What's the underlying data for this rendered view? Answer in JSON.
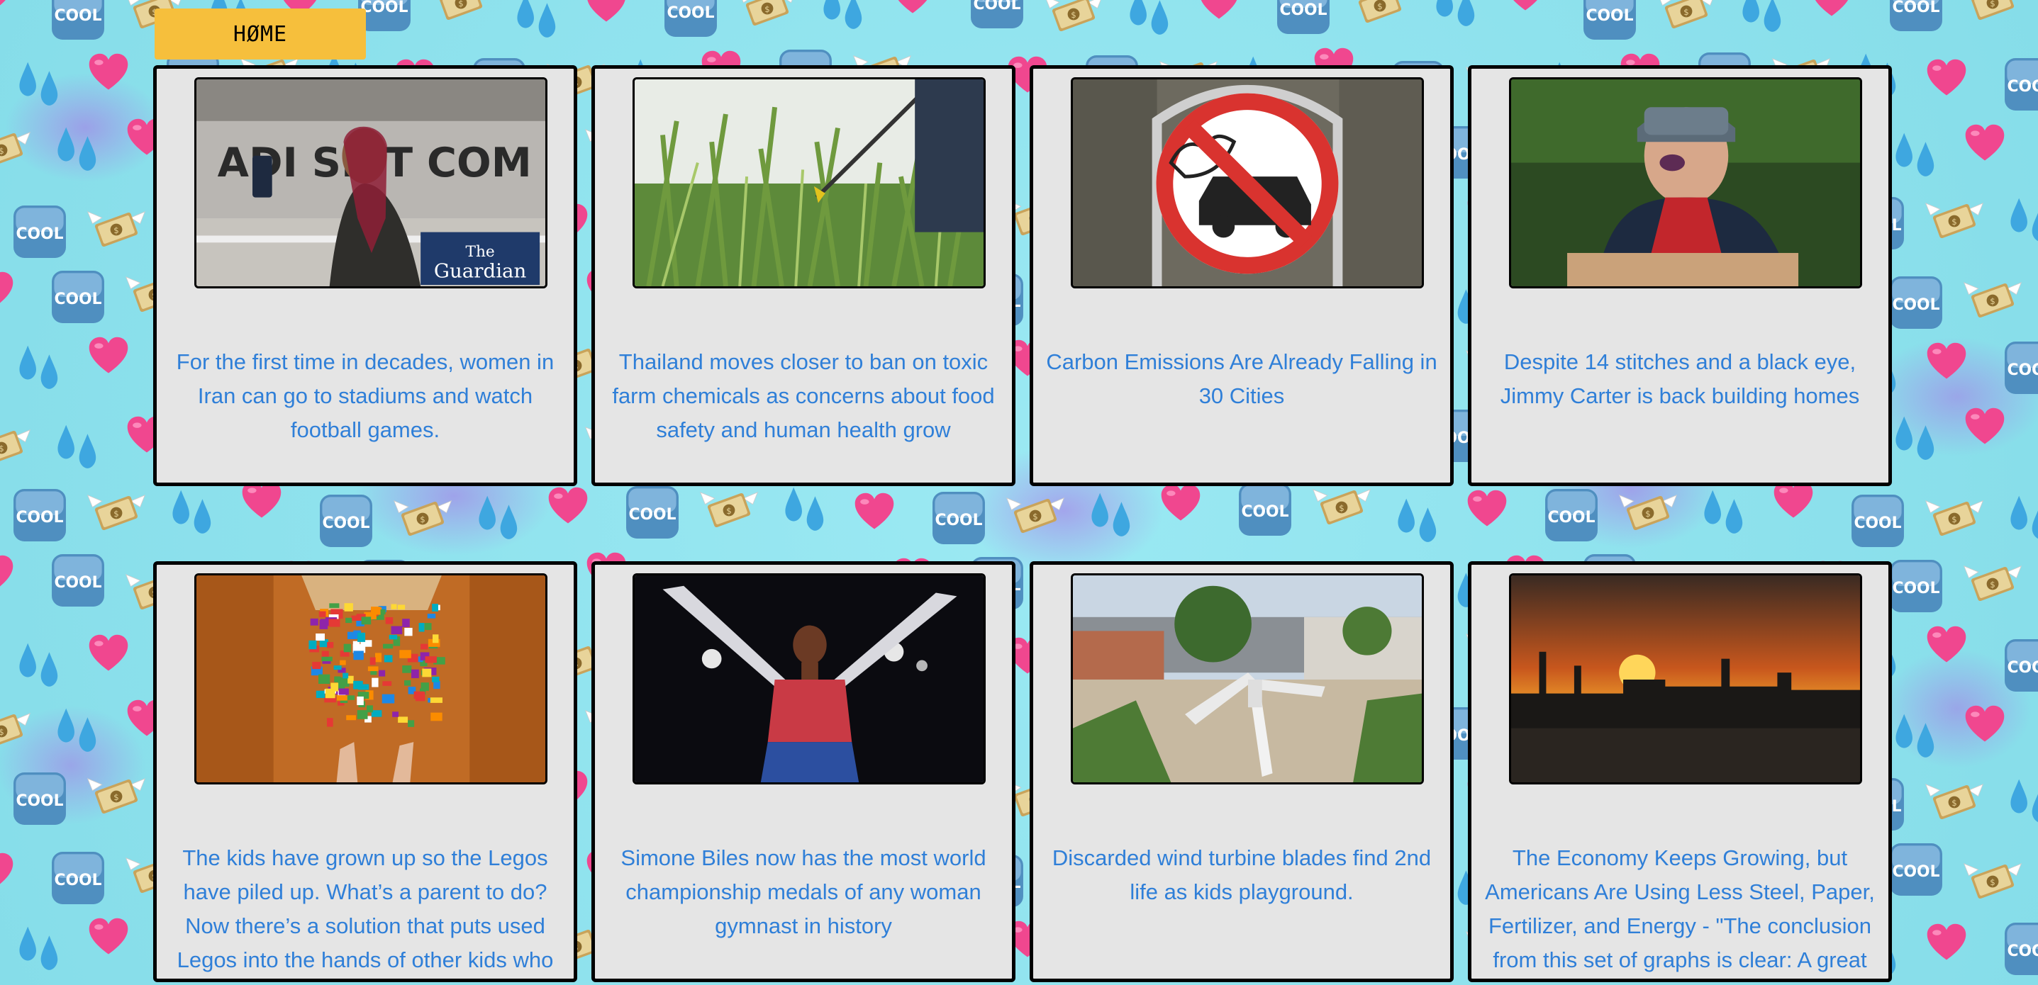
{
  "nav": {
    "home_label": "HØME"
  },
  "colors": {
    "home_button": "#f6bf3c",
    "card_background": "#e5e5e5",
    "link": "#2f7fd8",
    "page_background": "#8fe6f0"
  },
  "background_icons": [
    "heart-icon",
    "cool-icon",
    "money-wings-icon",
    "droplets-icon"
  ],
  "articles": [
    {
      "headline": "For the first time in decades, women in Iran can go to stadiums and watch football games.",
      "image": "woman-at-stadium-photo"
    },
    {
      "headline": "Thailand moves closer to ban on toxic farm chemicals as concerns about food safety and human health grow",
      "image": "crop-spraying-photo"
    },
    {
      "headline": "Carbon Emissions Are Already Falling in 30 Cities",
      "image": "no-car-emissions-sign-photo"
    },
    {
      "headline": "Despite 14 stitches and a black eye, Jimmy Carter is back building homes",
      "image": "jimmy-carter-building-photo"
    },
    {
      "headline": "The kids have grown up so the Legos have piled up. What’s a parent to do? Now there’s a solution that puts used Legos into the hands of other kids who",
      "image": "lego-box-photo"
    },
    {
      "headline": "Simone Biles now has the most world championship medals of any woman gymnast in history",
      "image": "gymnast-photo"
    },
    {
      "headline": "Discarded wind turbine blades find 2nd life as kids playground.",
      "image": "turbine-playground-photo"
    },
    {
      "headline": "The Economy Keeps Growing, but Americans Are Using Less Steel, Paper, Fertilizer, and Energy - \"The conclusion from this set of graphs is clear: A great",
      "image": "industrial-sunset-photo"
    }
  ]
}
